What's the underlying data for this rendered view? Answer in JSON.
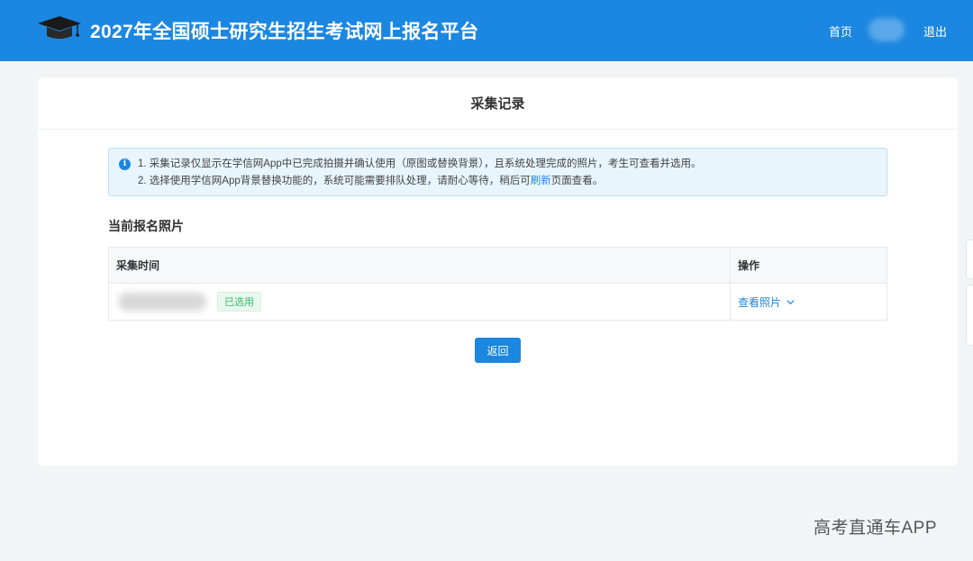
{
  "header": {
    "site_title": "2027年全国硕士研究生招生考试网上报名平台",
    "nav_home": "首页",
    "nav_logout": "退出",
    "logo_icon": "graduation-cap-icon",
    "bg_color": "#1c87e0"
  },
  "card": {
    "title": "采集记录",
    "notice": {
      "line1": "1. 采集记录仅显示在学信网App中已完成拍摄并确认使用（原图或替换背景），且系统处理完成的照片，考生可查看并选用。",
      "line2_before": "2. 选择使用学信网App背景替换功能的，系统可能需要排队处理，请耐心等待，稍后可",
      "line2_link": "刷新",
      "line2_after": "页面查看。"
    },
    "section_title": "当前报名照片",
    "table": {
      "headers": [
        "采集时间",
        "操作"
      ],
      "rows": [
        {
          "tag": "已选用",
          "action": "查看照片"
        }
      ]
    },
    "back_button": "返回"
  },
  "watermark": "高考直通车APP"
}
